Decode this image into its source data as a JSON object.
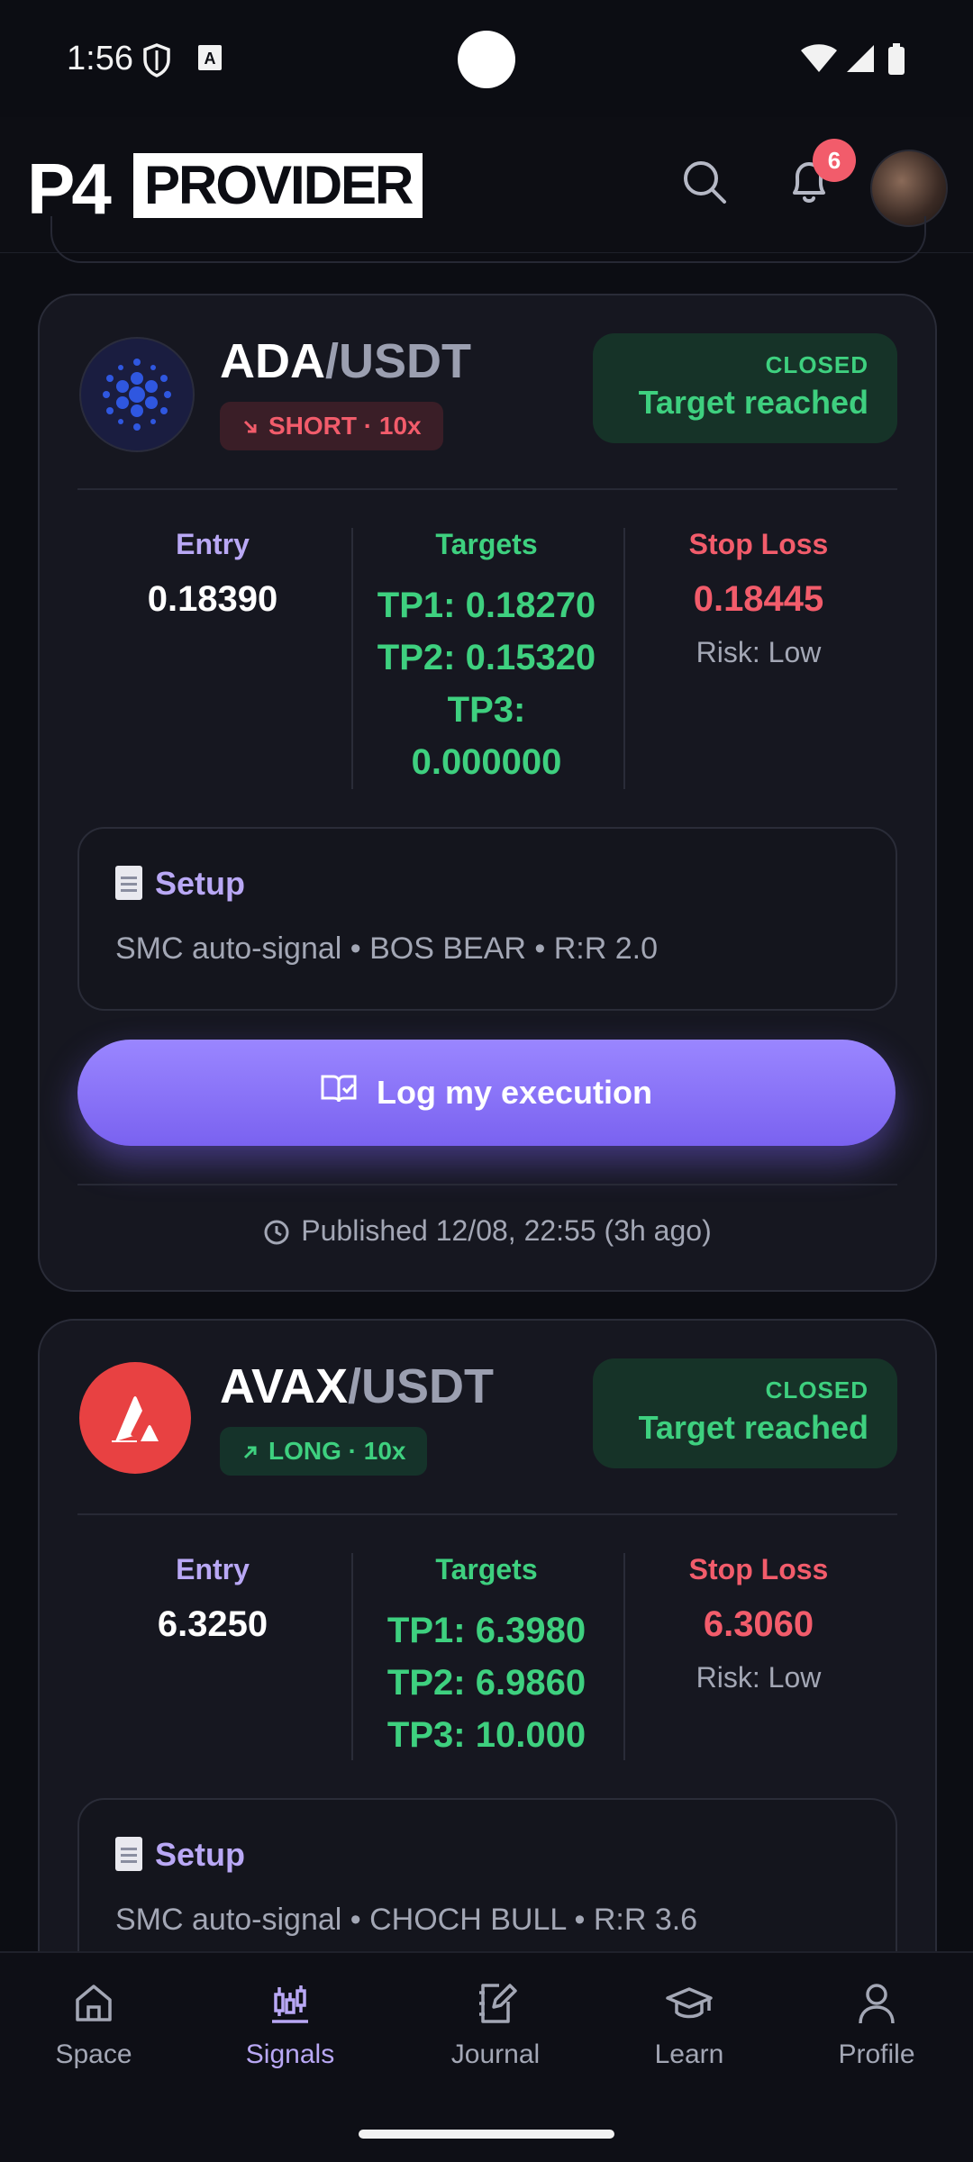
{
  "status_bar": {
    "time": "1:56"
  },
  "header": {
    "logo_mark": "P4",
    "logo_text": "PROVIDER",
    "notification_count": "6"
  },
  "signals": [
    {
      "base": "ADA",
      "quote": "/USDT",
      "direction": "SHORT · 10x",
      "status": "CLOSED",
      "status_label": "Target reached",
      "entry_label": "Entry",
      "entry": "0.18390",
      "targets_label": "Targets",
      "tp1": "TP1: 0.18270",
      "tp2": "TP2: 0.15320",
      "tp3a": "TP3:",
      "tp3b": "0.000000",
      "sl_label": "Stop Loss",
      "stop_loss": "0.18445",
      "risk": "Risk: Low",
      "setup_title": "Setup",
      "setup_text": "SMC auto-signal • BOS BEAR • R:R 2.0",
      "button": "Log my execution",
      "published": "Published 12/08, 22:55 (3h ago)"
    },
    {
      "base": "AVAX",
      "quote": "/USDT",
      "direction": "LONG · 10x",
      "status": "CLOSED",
      "status_label": "Target reached",
      "entry_label": "Entry",
      "entry": "6.3250",
      "targets_label": "Targets",
      "tp1": "TP1: 6.3980",
      "tp2": "TP2: 6.9860",
      "tp3": "TP3: 10.000",
      "sl_label": "Stop Loss",
      "stop_loss": "6.3060",
      "risk": "Risk: Low",
      "setup_title": "Setup",
      "setup_text": "SMC auto-signal • CHOCH BULL • R:R 3.6"
    }
  ],
  "nav": [
    {
      "label": "Space",
      "icon": "home-icon"
    },
    {
      "label": "Signals",
      "icon": "candlestick-icon",
      "active": true
    },
    {
      "label": "Journal",
      "icon": "journal-icon"
    },
    {
      "label": "Learn",
      "icon": "graduation-cap-icon"
    },
    {
      "label": "Profile",
      "icon": "user-icon"
    }
  ],
  "colors": {
    "accent": "#9a86ff",
    "positive": "#3ed07f",
    "negative": "#f25c6b",
    "background": "#0c0d13"
  }
}
